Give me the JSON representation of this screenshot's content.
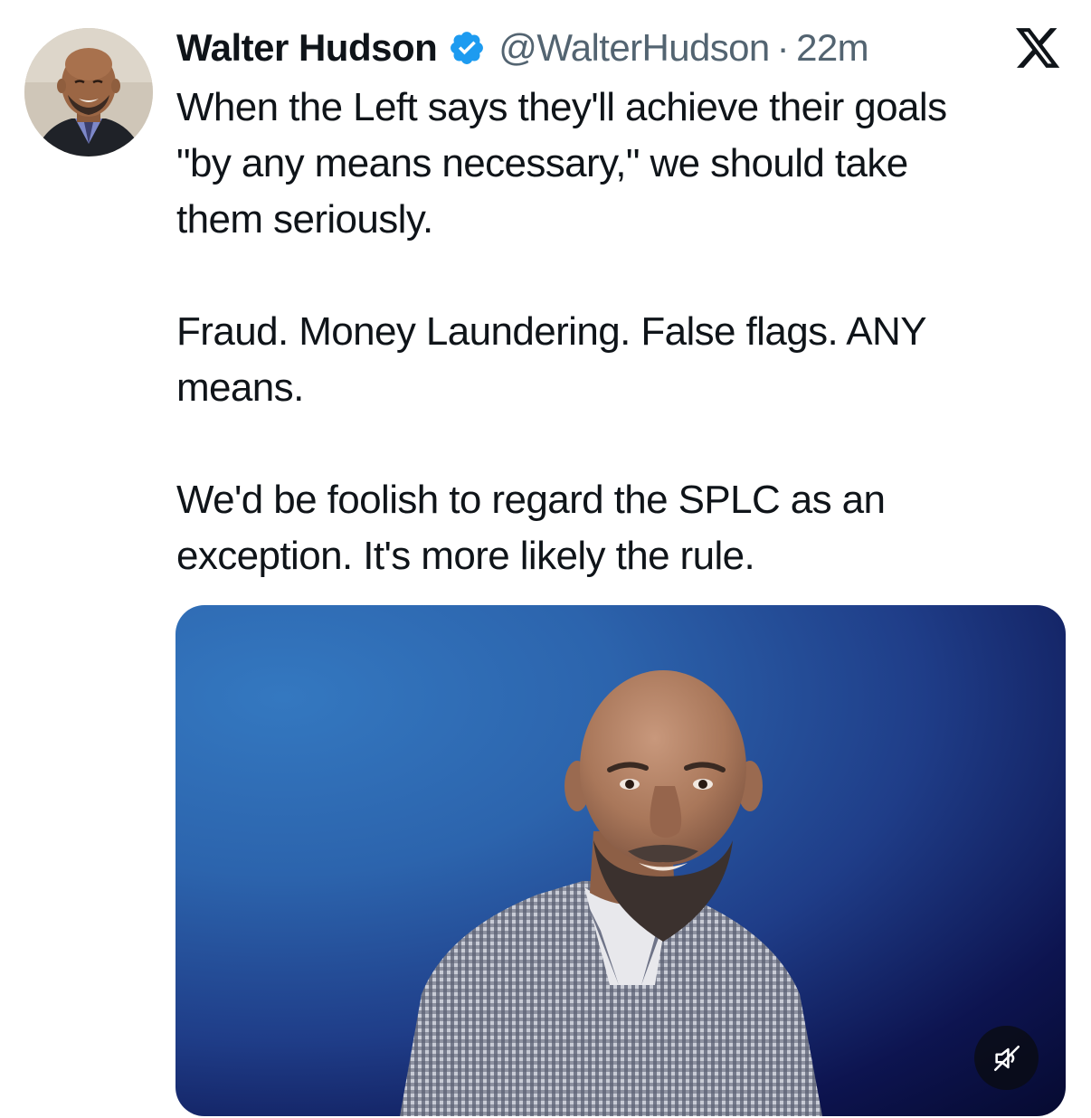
{
  "author": {
    "name": "Walter Hudson",
    "handle": "@WalterHudson",
    "separator": "·",
    "time": "22m",
    "verified": true,
    "avatar_icon": "profile-photo"
  },
  "tweet": {
    "paragraphs": [
      "When the Left says they'll achieve their goals\n\"by any means necessary,\" we should take\nthem seriously.",
      "Fraud. Money Laundering. False flags. ANY\nmeans.",
      "We'd be foolish to regard the SPLC as an\nexception. It's more likely the rule."
    ]
  },
  "media": {
    "type": "video",
    "muted": true,
    "control_icon": "speaker-muted-icon"
  },
  "brand": {
    "logo_icon": "x-logo-icon",
    "verified_color": "#1d9bf0"
  }
}
